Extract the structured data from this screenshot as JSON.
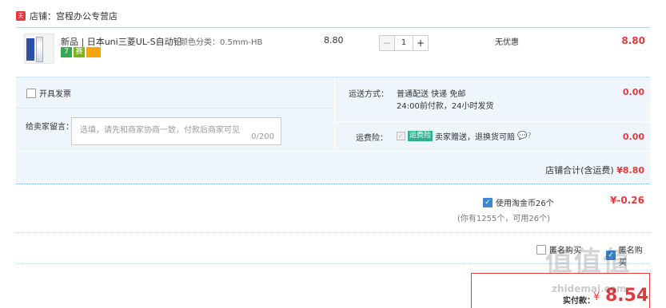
{
  "shop": {
    "label": "店铺：",
    "name": "宫程办公专营店"
  },
  "item": {
    "title": "新品 | 日本uni三菱UL-S自动铅...",
    "spec_label": "颜色分类：",
    "spec_value": "0.5mm-HB",
    "tags": [
      "7",
      "赛",
      ""
    ],
    "unit_price": "8.80",
    "quantity": "1",
    "minus_label": "−",
    "plus_label": "+",
    "discount": "无优惠",
    "subtotal": "8.80"
  },
  "order": {
    "invoice_label": "开具发票",
    "message_label": "给卖家留言：",
    "message_placeholder": "选填，请先和商家协商一致，付款后商家可见",
    "message_count": "0/200",
    "shipping_label": "运送方式：",
    "shipping_line1": "普通配送 快递 免邮",
    "shipping_line2": "24:00前付款，24小时发货",
    "shipping_price": "0.00",
    "insurance_label": "运费险：",
    "insurance_tag": "运费险",
    "insurance_text": "卖家赠送，退换货可赔",
    "insurance_price": "0.00",
    "shop_total_label": "店铺合计(含运费)",
    "shop_total_amount": "¥8.80"
  },
  "coins": {
    "label": "使用淘金币26个",
    "note": "(你有1255个，可用26个)",
    "amount": "¥-0.26",
    "checked": true
  },
  "extra": {
    "anonymous_label": "匿名购买",
    "hide_label": "匿名购买"
  },
  "payment": {
    "label": "实付款：",
    "currency": "¥",
    "amount": "8.54"
  },
  "watermark": {
    "main": "值值值",
    "sub": "zhidemai.com"
  },
  "colors": {
    "accent_red": "#e4393c",
    "panel_blue": "#eef6fc",
    "link_blue": "#3a88d6",
    "insurance_green": "#2db18f"
  }
}
